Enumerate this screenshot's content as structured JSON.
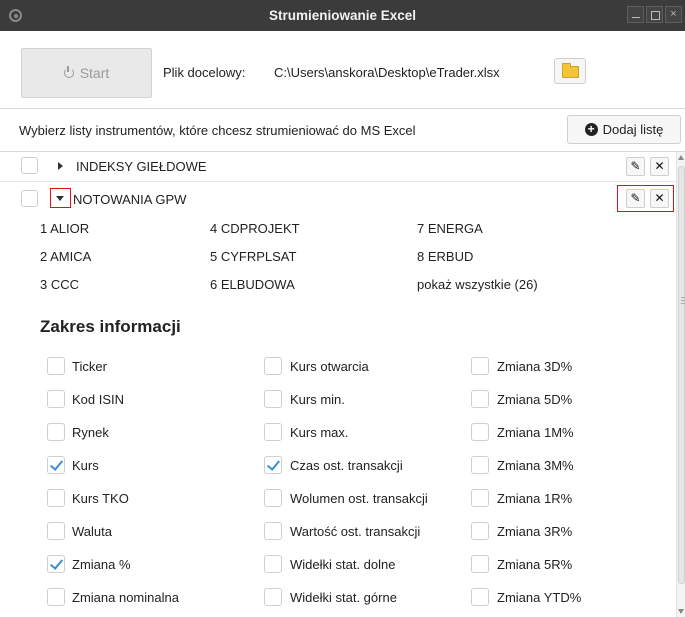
{
  "window": {
    "title": "Strumieniowanie Excel",
    "close_symbol": "×"
  },
  "toolbar": {
    "start_label": "Start",
    "target_label": "Plik docelowy:",
    "target_path": "C:\\Users\\anskora\\Desktop\\eTrader.xlsx"
  },
  "instructions": "Wybierz listy instrumentów, które chcesz strumieniować do MS Excel",
  "add_list_label": "Dodaj listę",
  "groups": [
    {
      "name": "INDEKSY GIEŁDOWE",
      "expanded": false
    },
    {
      "name": "NOTOWANIA GPW",
      "expanded": true
    }
  ],
  "instruments": [
    "1 ALIOR",
    "2 AMICA",
    "3 CCC",
    "4 CDPROJEKT",
    "5 CYFRPLSAT",
    "6 ELBUDOWA",
    "7 ENERGA",
    "8 ERBUD",
    "pokaż wszystkie (26)"
  ],
  "info_section": {
    "title": "Zakres informacji",
    "options": [
      {
        "label": "Ticker",
        "checked": false
      },
      {
        "label": "Kod ISIN",
        "checked": false
      },
      {
        "label": "Rynek",
        "checked": false
      },
      {
        "label": "Kurs",
        "checked": true
      },
      {
        "label": "Kurs TKO",
        "checked": false
      },
      {
        "label": "Waluta",
        "checked": false
      },
      {
        "label": "Zmiana %",
        "checked": true
      },
      {
        "label": "Zmiana nominalna",
        "checked": false
      },
      {
        "label": "Kurs otwarcia",
        "checked": false
      },
      {
        "label": "Kurs min.",
        "checked": false
      },
      {
        "label": "Kurs max.",
        "checked": false
      },
      {
        "label": "Czas ost. transakcji",
        "checked": true
      },
      {
        "label": "Wolumen ost. transakcji",
        "checked": false
      },
      {
        "label": "Wartość ost. transakcji",
        "checked": false
      },
      {
        "label": "Widełki stat. dolne",
        "checked": false
      },
      {
        "label": "Widełki stat. górne",
        "checked": false
      },
      {
        "label": "Zmiana 3D%",
        "checked": false
      },
      {
        "label": "Zmiana 5D%",
        "checked": false
      },
      {
        "label": "Zmiana 1M%",
        "checked": false
      },
      {
        "label": "Zmiana 3M%",
        "checked": false
      },
      {
        "label": "Zmiana 1R%",
        "checked": false
      },
      {
        "label": "Zmiana 3R%",
        "checked": false
      },
      {
        "label": "Zmiana 5R%",
        "checked": false
      },
      {
        "label": "Zmiana YTD%",
        "checked": false
      }
    ]
  },
  "colors": {
    "titlebar": "#3b3b3b",
    "highlight": "#dd1111",
    "check": "#3a8fd6",
    "folder": "#f3c33a"
  },
  "icons": {
    "edit": "pencil-icon",
    "remove": "close-icon",
    "start": "power-icon",
    "browse": "folder-icon",
    "add": "plus-circle-icon"
  }
}
